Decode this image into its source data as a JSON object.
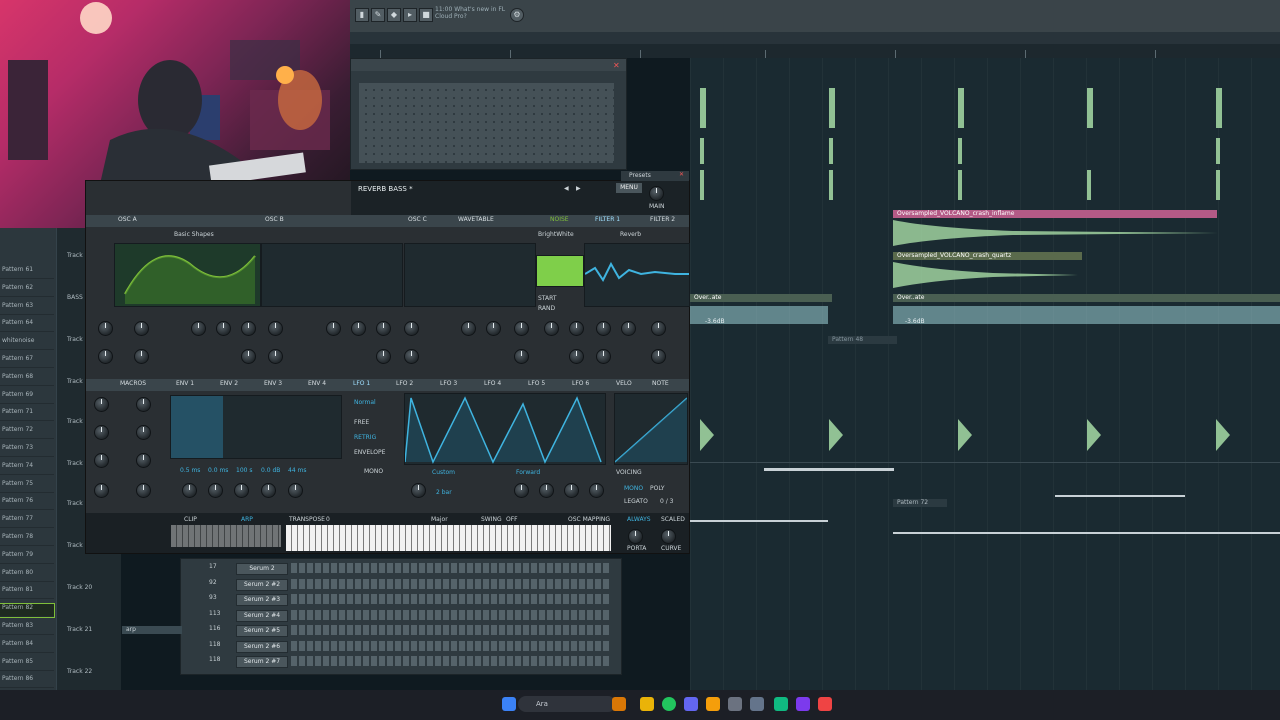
{
  "toolbar": {
    "hint_line1": "11:00 What's new in FL",
    "hint_line2": "Cloud Pro?"
  },
  "serum": {
    "preset_name": "REVERB BASS *",
    "presets_label": "Presets",
    "osc_a_label": "OSC A",
    "osc_b_label": "OSC B",
    "osc_c_label": "OSC C",
    "wavetable_label": "WAVETABLE",
    "wavetable_name": "Basic Shapes",
    "noise_label": "NOISE",
    "noise_name": "BrightWhite",
    "filter1_label": "FILTER 1",
    "filter2_label": "FILTER 2",
    "reverb_label": "Reverb",
    "menu_label": "MENU",
    "main_label": "MAIN",
    "start_label": "START",
    "rand_label": "RAND",
    "macros_label": "MACROS",
    "mod_tabs": [
      "ENV 1",
      "ENV 2",
      "ENV 3",
      "ENV 4",
      "LFO 1",
      "LFO 2",
      "LFO 3",
      "LFO 4",
      "LFO 5",
      "LFO 6",
      "VELO",
      "NOTE"
    ],
    "lfo_mode": "Normal",
    "lfo_options": [
      "FREE",
      "RETRIG",
      "ENVELOPE"
    ],
    "lfo_shape": "Custom",
    "lfo_direction": "Forward",
    "lfo_rate": "2 bar",
    "mono_label": "MONO",
    "poly_label": "POLY",
    "voicing_label": "VOICING",
    "legato_label": "LEGATO",
    "voice_count": "0 / 3",
    "always_label": "ALWAYS",
    "scaled_label": "SCALED",
    "clip_label": "CLIP",
    "arp_label": "ARP",
    "transpose_label": "TRANSPOSE",
    "transpose_value": "0",
    "swing_label": "SWING",
    "swing_value": "OFF",
    "key_label": "Major",
    "osc_mapping_label": "OSC MAPPING",
    "porta_label": "PORTA",
    "curve_label": "CURVE",
    "env_values": [
      "0.5 ms",
      "0.0 ms",
      "100 s",
      "0.0 dB",
      "44 ms"
    ]
  },
  "playlist": {
    "track_names": [
      "Pattern 61",
      "Pattern 62",
      "Pattern 63",
      "Pattern 64",
      "whitenoise",
      "Pattern 67",
      "Pattern 68",
      "Pattern 69",
      "Pattern 71",
      "Pattern 72",
      "Pattern 73",
      "Pattern 74",
      "Pattern 75",
      "Pattern 76",
      "Pattern 77",
      "Pattern 78",
      "Pattern 79",
      "Pattern 80",
      "Pattern 81",
      "Pattern 82",
      "Pattern 83",
      "Pattern 84",
      "Pattern 85",
      "Pattern 86"
    ],
    "selected_track": "Pattern 82",
    "track_labels": [
      "Track",
      "BASS",
      "Track",
      "Track",
      "Track",
      "Track",
      "Track",
      "Track",
      "Track 20",
      "Track 21",
      "Track 22"
    ],
    "clip_crash_inflame": "Oversampled_VOLCANO_crash_inflame",
    "clip_crash_quartz": "Oversampled_VOLCANO_crash_quartz",
    "clip_overate": "Over..ate",
    "clip_db": "-3.6dB",
    "pattern_48": "Pattern 48",
    "pattern_72": "Pattern 72",
    "arp_clip": "arp"
  },
  "channel_rack": {
    "channels": [
      {
        "num": "17",
        "name": "Serum 2"
      },
      {
        "num": "92",
        "name": "Serum 2 #2"
      },
      {
        "num": "93",
        "name": "Serum 2 #3"
      },
      {
        "num": "113",
        "name": "Serum 2 #4"
      },
      {
        "num": "116",
        "name": "Serum 2 #5"
      },
      {
        "num": "118",
        "name": "Serum 2 #6"
      },
      {
        "num": "118",
        "name": "Serum 2 #7"
      }
    ]
  },
  "taskbar": {
    "search_placeholder": "Ara"
  },
  "colors": {
    "accent_green": "#7fbf3a",
    "waveform_green": "#a7dca6",
    "lfo_blue": "#3fb4e0",
    "clip_pink": "#b45a86"
  }
}
